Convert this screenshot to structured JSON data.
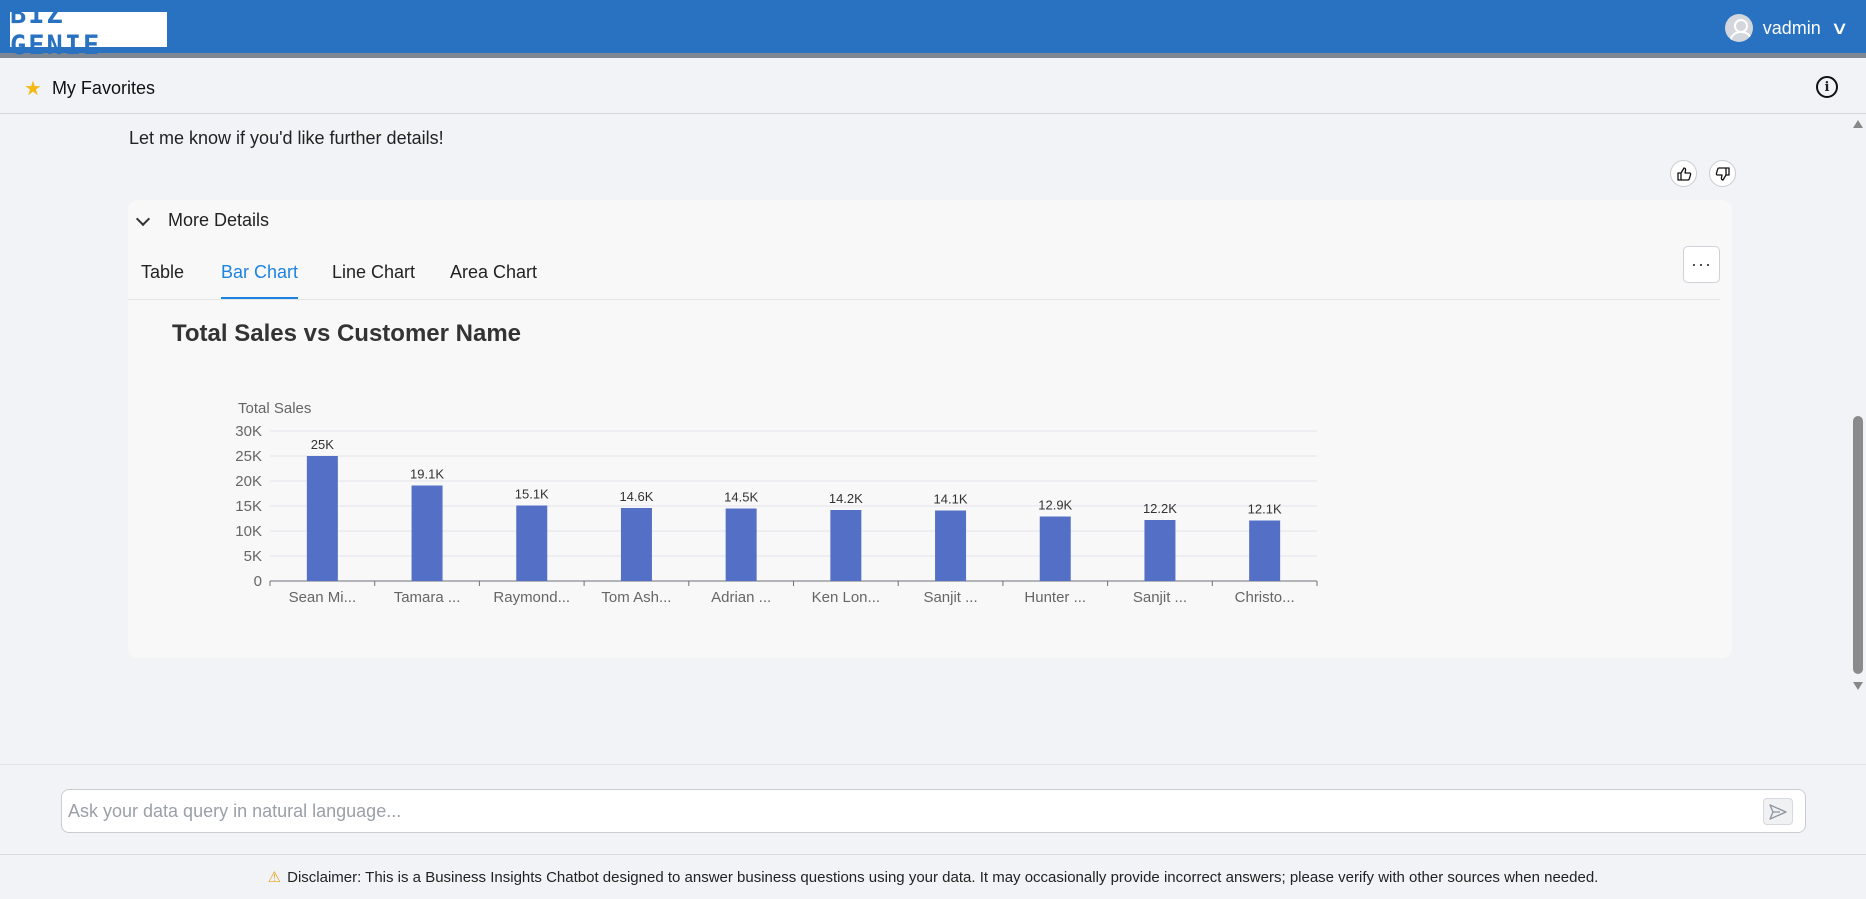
{
  "header": {
    "logo_text": "BIZ GENIE",
    "username": "vadmin",
    "brand_color": "#2872c1"
  },
  "favorites": {
    "label": "My Favorites",
    "icon": "star-icon"
  },
  "message": {
    "text": "Let me know if you'd like further details!",
    "thumbs_up_icon": "thumbs-up-icon",
    "thumbs_down_icon": "thumbs-down-icon"
  },
  "details": {
    "toggle_label": "More Details",
    "tabs": [
      {
        "label": "Table",
        "active": false
      },
      {
        "label": "Bar Chart",
        "active": true
      },
      {
        "label": "Line Chart",
        "active": false
      },
      {
        "label": "Area Chart",
        "active": false
      }
    ],
    "more_button": "···"
  },
  "chart_data": {
    "type": "bar",
    "title": "Total Sales vs Customer Name",
    "xlabel": "",
    "ylabel": "Total Sales",
    "ylim": [
      0,
      30000
    ],
    "yticks": [
      "0",
      "5K",
      "10K",
      "15K",
      "20K",
      "25K",
      "30K"
    ],
    "categories": [
      "Sean Mi...",
      "Tamara ...",
      "Raymond...",
      "Tom Ash...",
      "Adrian ...",
      "Ken Lon...",
      "Sanjit ...",
      "Hunter ...",
      "Sanjit ...",
      "Christo..."
    ],
    "values": [
      25000,
      19100,
      15100,
      14600,
      14500,
      14200,
      14100,
      12900,
      12200,
      12100
    ],
    "data_labels": [
      "25K",
      "19.1K",
      "15.1K",
      "14.6K",
      "14.5K",
      "14.2K",
      "14.1K",
      "12.9K",
      "12.2K",
      "12.1K"
    ],
    "bar_color": "#5470c6",
    "grid": true
  },
  "query": {
    "placeholder": "Ask your data query in natural language...",
    "value": "",
    "send_icon": "send-icon"
  },
  "disclaimer": {
    "text": "Disclaimer: This is a Business Insights Chatbot designed to answer business questions using your data. It may occasionally provide incorrect answers; please verify with other sources when needed.",
    "icon": "warning-icon"
  }
}
